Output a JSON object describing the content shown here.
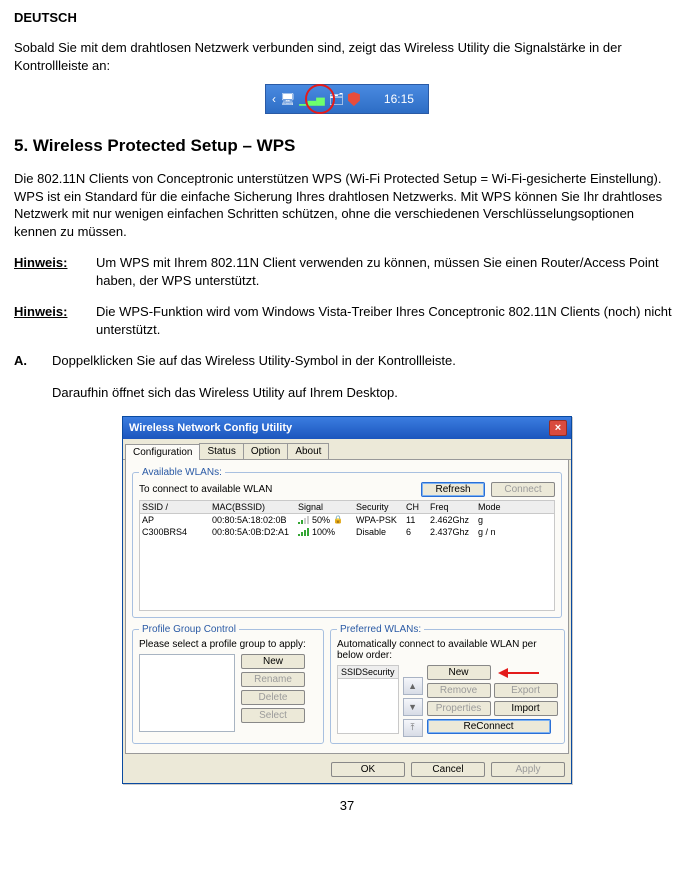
{
  "header": "DEUTSCH",
  "intro": "Sobald Sie mit dem drahtlosen Netzwerk verbunden sind, zeigt das Wireless Utility die Signalstärke in der Kontrollleiste an:",
  "tray": {
    "clock": "16:15"
  },
  "section_title": "5.   Wireless Protected Setup – WPS",
  "para1": "Die 802.11N Clients von Conceptronic unterstützen WPS (Wi-Fi Protected Setup = Wi-Fi-gesicherte Einstellung). WPS ist ein Standard für die einfache Sicherung Ihres drahtlosen Netzwerks. Mit WPS können Sie Ihr drahtloses Netzwerk mit nur wenigen einfachen Schritten schützen, ohne die verschiedenen Verschlüsselungsoptionen kennen zu müssen.",
  "notes": {
    "label": "Hinweis:",
    "n1": "Um WPS mit Ihrem 802.11N Client verwenden zu können, müssen Sie einen Router/Access Point haben, der WPS unterstützt.",
    "n2": "Die WPS-Funktion wird vom Windows Vista-Treiber Ihres Conceptronic 802.11N Clients (noch) nicht unterstützt."
  },
  "step_a_label": "A.",
  "step_a": "Doppelklicken Sie auf das Wireless Utility-Symbol in der Kontrollleiste.",
  "step_a2": "Daraufhin öffnet sich das Wireless Utility auf Ihrem Desktop.",
  "dialog": {
    "title": "Wireless Network Config Utility",
    "tabs": [
      "Configuration",
      "Status",
      "Option",
      "About"
    ],
    "avail_legend": "Available WLANs:",
    "avail_text": "To connect to available WLAN",
    "btn_refresh": "Refresh",
    "btn_connect": "Connect",
    "cols": {
      "ssid": "SSID   /",
      "mac": "MAC(BSSID)",
      "signal": "Signal",
      "security": "Security",
      "ch": "CH",
      "freq": "Freq",
      "mode": "Mode"
    },
    "rows": [
      {
        "ssid": "AP",
        "mac": "00:80:5A:18:02:0B",
        "signal": "50%",
        "lock": true,
        "security": "WPA-PSK",
        "ch": "11",
        "freq": "2.462Ghz",
        "mode": "g"
      },
      {
        "ssid": "C300BRS4",
        "mac": "00:80:5A:0B:D2:A1",
        "signal": "100%",
        "lock": false,
        "security": "Disable",
        "ch": "6",
        "freq": "2.437Ghz",
        "mode": "g / n"
      }
    ],
    "pg_legend": "Profile Group Control",
    "pg_text": "Please select a profile group to apply:",
    "pg_new": "New",
    "pg_rename": "Rename",
    "pg_delete": "Delete",
    "pg_select": "Select",
    "pref_legend": "Preferred WLANs:",
    "pref_text": "Automatically connect to available WLAN per below order:",
    "pref_cols": {
      "ssid": "SSID",
      "security": "Security"
    },
    "pref_new": "New",
    "pref_remove": "Remove",
    "pref_properties": "Properties",
    "pref_export": "Export",
    "pref_import": "Import",
    "pref_reconnect": "ReConnect",
    "ok": "OK",
    "cancel": "Cancel",
    "apply": "Apply"
  },
  "page_number": "37"
}
